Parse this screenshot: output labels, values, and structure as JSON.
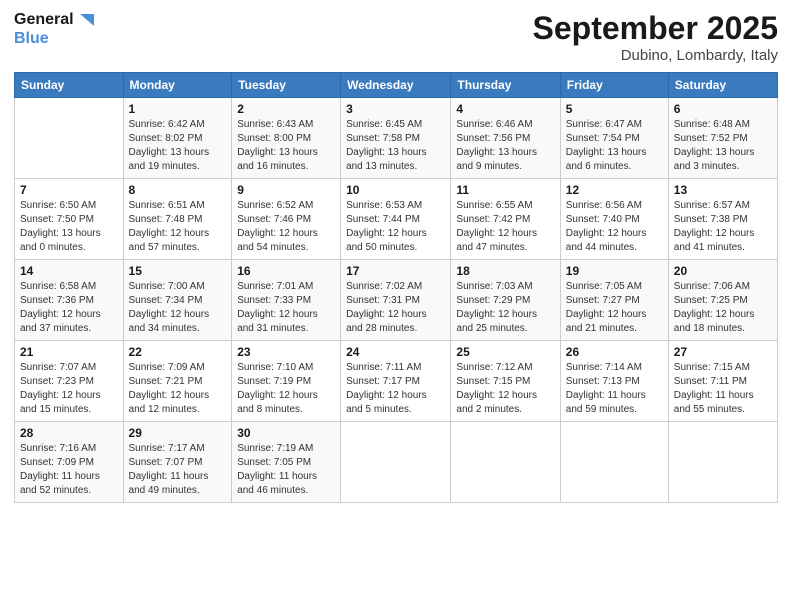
{
  "header": {
    "logo_line1": "General",
    "logo_line2": "Blue",
    "month": "September 2025",
    "location": "Dubino, Lombardy, Italy"
  },
  "days_of_week": [
    "Sunday",
    "Monday",
    "Tuesday",
    "Wednesday",
    "Thursday",
    "Friday",
    "Saturday"
  ],
  "weeks": [
    [
      {
        "day": "",
        "sunrise": "",
        "sunset": "",
        "daylight": ""
      },
      {
        "day": "1",
        "sunrise": "Sunrise: 6:42 AM",
        "sunset": "Sunset: 8:02 PM",
        "daylight": "Daylight: 13 hours and 19 minutes."
      },
      {
        "day": "2",
        "sunrise": "Sunrise: 6:43 AM",
        "sunset": "Sunset: 8:00 PM",
        "daylight": "Daylight: 13 hours and 16 minutes."
      },
      {
        "day": "3",
        "sunrise": "Sunrise: 6:45 AM",
        "sunset": "Sunset: 7:58 PM",
        "daylight": "Daylight: 13 hours and 13 minutes."
      },
      {
        "day": "4",
        "sunrise": "Sunrise: 6:46 AM",
        "sunset": "Sunset: 7:56 PM",
        "daylight": "Daylight: 13 hours and 9 minutes."
      },
      {
        "day": "5",
        "sunrise": "Sunrise: 6:47 AM",
        "sunset": "Sunset: 7:54 PM",
        "daylight": "Daylight: 13 hours and 6 minutes."
      },
      {
        "day": "6",
        "sunrise": "Sunrise: 6:48 AM",
        "sunset": "Sunset: 7:52 PM",
        "daylight": "Daylight: 13 hours and 3 minutes."
      }
    ],
    [
      {
        "day": "7",
        "sunrise": "Sunrise: 6:50 AM",
        "sunset": "Sunset: 7:50 PM",
        "daylight": "Daylight: 13 hours and 0 minutes."
      },
      {
        "day": "8",
        "sunrise": "Sunrise: 6:51 AM",
        "sunset": "Sunset: 7:48 PM",
        "daylight": "Daylight: 12 hours and 57 minutes."
      },
      {
        "day": "9",
        "sunrise": "Sunrise: 6:52 AM",
        "sunset": "Sunset: 7:46 PM",
        "daylight": "Daylight: 12 hours and 54 minutes."
      },
      {
        "day": "10",
        "sunrise": "Sunrise: 6:53 AM",
        "sunset": "Sunset: 7:44 PM",
        "daylight": "Daylight: 12 hours and 50 minutes."
      },
      {
        "day": "11",
        "sunrise": "Sunrise: 6:55 AM",
        "sunset": "Sunset: 7:42 PM",
        "daylight": "Daylight: 12 hours and 47 minutes."
      },
      {
        "day": "12",
        "sunrise": "Sunrise: 6:56 AM",
        "sunset": "Sunset: 7:40 PM",
        "daylight": "Daylight: 12 hours and 44 minutes."
      },
      {
        "day": "13",
        "sunrise": "Sunrise: 6:57 AM",
        "sunset": "Sunset: 7:38 PM",
        "daylight": "Daylight: 12 hours and 41 minutes."
      }
    ],
    [
      {
        "day": "14",
        "sunrise": "Sunrise: 6:58 AM",
        "sunset": "Sunset: 7:36 PM",
        "daylight": "Daylight: 12 hours and 37 minutes."
      },
      {
        "day": "15",
        "sunrise": "Sunrise: 7:00 AM",
        "sunset": "Sunset: 7:34 PM",
        "daylight": "Daylight: 12 hours and 34 minutes."
      },
      {
        "day": "16",
        "sunrise": "Sunrise: 7:01 AM",
        "sunset": "Sunset: 7:33 PM",
        "daylight": "Daylight: 12 hours and 31 minutes."
      },
      {
        "day": "17",
        "sunrise": "Sunrise: 7:02 AM",
        "sunset": "Sunset: 7:31 PM",
        "daylight": "Daylight: 12 hours and 28 minutes."
      },
      {
        "day": "18",
        "sunrise": "Sunrise: 7:03 AM",
        "sunset": "Sunset: 7:29 PM",
        "daylight": "Daylight: 12 hours and 25 minutes."
      },
      {
        "day": "19",
        "sunrise": "Sunrise: 7:05 AM",
        "sunset": "Sunset: 7:27 PM",
        "daylight": "Daylight: 12 hours and 21 minutes."
      },
      {
        "day": "20",
        "sunrise": "Sunrise: 7:06 AM",
        "sunset": "Sunset: 7:25 PM",
        "daylight": "Daylight: 12 hours and 18 minutes."
      }
    ],
    [
      {
        "day": "21",
        "sunrise": "Sunrise: 7:07 AM",
        "sunset": "Sunset: 7:23 PM",
        "daylight": "Daylight: 12 hours and 15 minutes."
      },
      {
        "day": "22",
        "sunrise": "Sunrise: 7:09 AM",
        "sunset": "Sunset: 7:21 PM",
        "daylight": "Daylight: 12 hours and 12 minutes."
      },
      {
        "day": "23",
        "sunrise": "Sunrise: 7:10 AM",
        "sunset": "Sunset: 7:19 PM",
        "daylight": "Daylight: 12 hours and 8 minutes."
      },
      {
        "day": "24",
        "sunrise": "Sunrise: 7:11 AM",
        "sunset": "Sunset: 7:17 PM",
        "daylight": "Daylight: 12 hours and 5 minutes."
      },
      {
        "day": "25",
        "sunrise": "Sunrise: 7:12 AM",
        "sunset": "Sunset: 7:15 PM",
        "daylight": "Daylight: 12 hours and 2 minutes."
      },
      {
        "day": "26",
        "sunrise": "Sunrise: 7:14 AM",
        "sunset": "Sunset: 7:13 PM",
        "daylight": "Daylight: 11 hours and 59 minutes."
      },
      {
        "day": "27",
        "sunrise": "Sunrise: 7:15 AM",
        "sunset": "Sunset: 7:11 PM",
        "daylight": "Daylight: 11 hours and 55 minutes."
      }
    ],
    [
      {
        "day": "28",
        "sunrise": "Sunrise: 7:16 AM",
        "sunset": "Sunset: 7:09 PM",
        "daylight": "Daylight: 11 hours and 52 minutes."
      },
      {
        "day": "29",
        "sunrise": "Sunrise: 7:17 AM",
        "sunset": "Sunset: 7:07 PM",
        "daylight": "Daylight: 11 hours and 49 minutes."
      },
      {
        "day": "30",
        "sunrise": "Sunrise: 7:19 AM",
        "sunset": "Sunset: 7:05 PM",
        "daylight": "Daylight: 11 hours and 46 minutes."
      },
      {
        "day": "",
        "sunrise": "",
        "sunset": "",
        "daylight": ""
      },
      {
        "day": "",
        "sunrise": "",
        "sunset": "",
        "daylight": ""
      },
      {
        "day": "",
        "sunrise": "",
        "sunset": "",
        "daylight": ""
      },
      {
        "day": "",
        "sunrise": "",
        "sunset": "",
        "daylight": ""
      }
    ]
  ]
}
